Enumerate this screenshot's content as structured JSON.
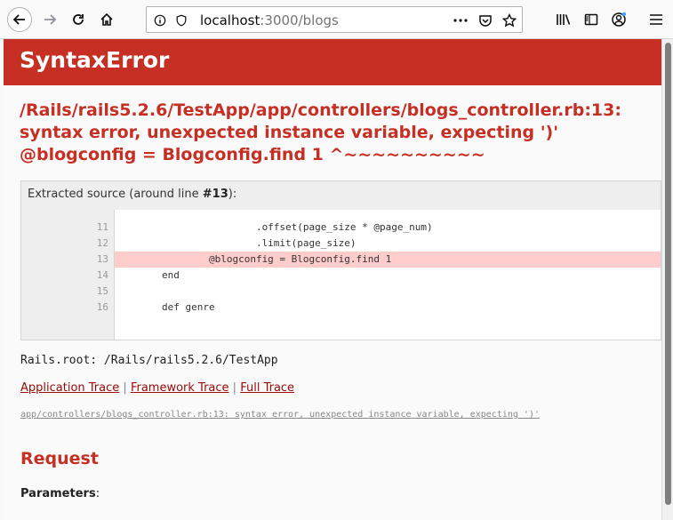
{
  "browser": {
    "url_host": "localhost",
    "url_rest": ":3000/blogs"
  },
  "error": {
    "title": "SyntaxError",
    "message": "/Rails/rails5.2.6/TestApp/app/controllers/blogs_controller.rb:13: syntax error, unexpected instance variable, expecting ')' @blogconfig = Blogconfig.find 1 ^~~~~~~~~~~"
  },
  "source": {
    "caption_prefix": "Extracted source (around line ",
    "caption_line": "#13",
    "caption_suffix": "):",
    "lines": [
      {
        "num": "11",
        "code": "                        .offset(page_size * @page_num)"
      },
      {
        "num": "12",
        "code": "                        .limit(page_size)"
      },
      {
        "num": "13",
        "code": "                @blogconfig = Blogconfig.find 1"
      },
      {
        "num": "14",
        "code": "        end"
      },
      {
        "num": "15",
        "code": ""
      },
      {
        "num": "16",
        "code": "        def genre"
      }
    ],
    "highlight_line": "13"
  },
  "rails_root": "Rails.root: /Rails/rails5.2.6/TestApp",
  "traces": {
    "application": "Application Trace",
    "framework": "Framework Trace",
    "full": "Full Trace",
    "sep": "|"
  },
  "trace_line": "app/controllers/blogs_controller.rb:13: syntax error, unexpected instance variable, expecting ')'",
  "request": {
    "heading": "Request",
    "params_label": "Parameters",
    "params_colon": ":"
  }
}
